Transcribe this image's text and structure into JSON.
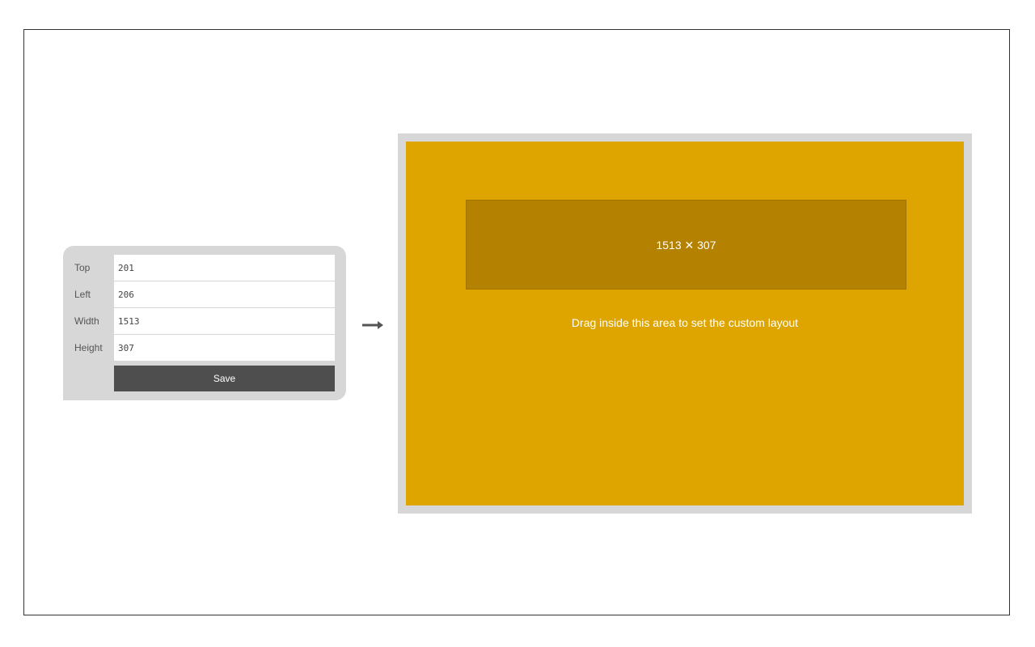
{
  "form": {
    "fields": [
      {
        "label": "Top",
        "value": "201"
      },
      {
        "label": "Left",
        "value": "206"
      },
      {
        "label": "Width",
        "value": "1513"
      },
      {
        "label": "Height",
        "value": "307"
      }
    ],
    "save_label": "Save"
  },
  "arrow_icon": "right-arrow-icon",
  "stage": {
    "selection_label": "1513 ✕ 307",
    "hint": "Drag inside this area to set the custom layout"
  },
  "colors": {
    "stage": "#dea500",
    "selection": "#b48200",
    "panel": "#d7d7d7",
    "button": "#4e4e4e"
  }
}
